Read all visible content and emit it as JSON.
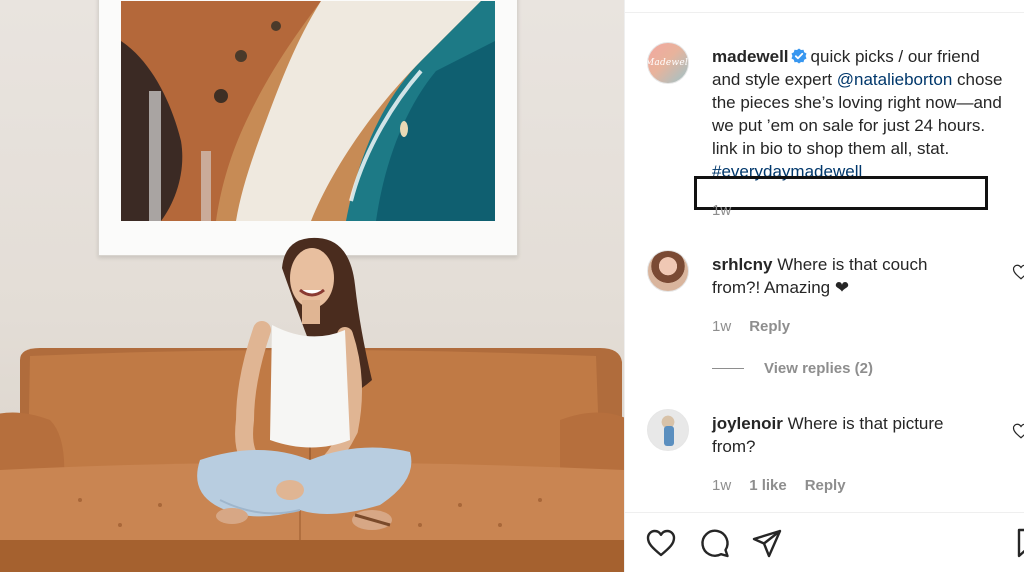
{
  "post": {
    "username": "madewell",
    "avatar_text": "Madewell",
    "verified": true,
    "caption_lines": [
      "quick picks / our friend",
      "and style expert",
      "@natalieborton",
      "chose",
      "the pieces she’s loving right now—and",
      "we put ’em on sale for just 24 hours.",
      "link in bio to shop them all, stat.",
      "#everydaymadewell"
    ],
    "time": "1w"
  },
  "comments": [
    {
      "username": "srhlcny",
      "text_line1": "Where is that couch",
      "text_line2": "from?! Amazing ❤",
      "time": "1w",
      "reply_label": "Reply",
      "view_replies": "View replies (2)"
    },
    {
      "username": "joylenoir",
      "text_line1": "Where is that picture",
      "text_line2": "from?",
      "time": "1w",
      "likes": "1 like",
      "reply_label": "Reply"
    }
  ],
  "icons": {
    "like": "heart-icon",
    "comment": "comment-icon",
    "share": "share-icon",
    "save": "bookmark-icon",
    "verified": "verified-badge-icon"
  },
  "colors": {
    "link": "#00376b",
    "verified": "#3897f0",
    "muted": "#8e8e8e",
    "text": "#262626"
  }
}
